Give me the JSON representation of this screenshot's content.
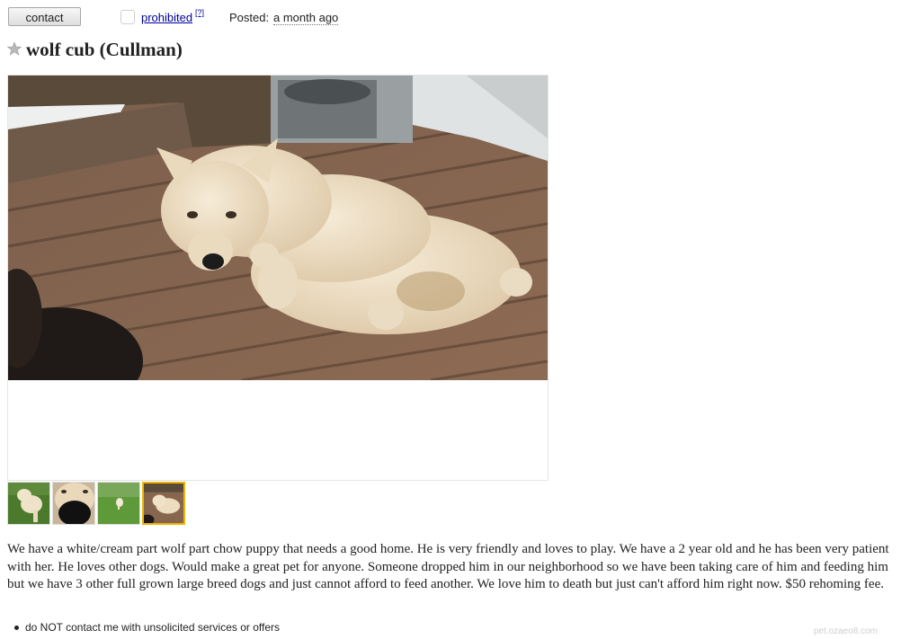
{
  "topbar": {
    "contact_label": "contact",
    "flag_label": "prohibited",
    "help_label": "[?]",
    "posted_label": "Posted:",
    "posted_value": "a month ago"
  },
  "posting": {
    "title": "wolf cub (Cullman)",
    "body": "We have a white/cream part wolf part chow puppy that needs a good home. He is very friendly and loves to play. We have a 2 year old and he has been very patient with her. He loves other dogs. Would make a great pet for anyone. Someone dropped him in our neighborhood so we have been taking care of him and feeding him but we have 3 other full grown large breed dogs and just cannot afford to feed another. We love him to death but just can't afford him right now. $50 rehoming fee.",
    "notices": [
      "do NOT contact me with unsolicited services or offers"
    ]
  },
  "gallery": {
    "main_image_icon": "photo-dog-on-deck",
    "thumbnails": [
      {
        "icon": "photo-dog-on-grass",
        "selected": false
      },
      {
        "icon": "photo-dog-closeup",
        "selected": false
      },
      {
        "icon": "photo-dog-far-on-grass",
        "selected": false
      },
      {
        "icon": "photo-dog-on-deck",
        "selected": true
      }
    ]
  },
  "watermark": "pet.ozaeo8.com",
  "colors": {
    "link": "#00009a",
    "selected_thumb_border": "#f0b400",
    "deck_wood": "#8a6a52",
    "dog_fur": "#ecdcc0"
  }
}
